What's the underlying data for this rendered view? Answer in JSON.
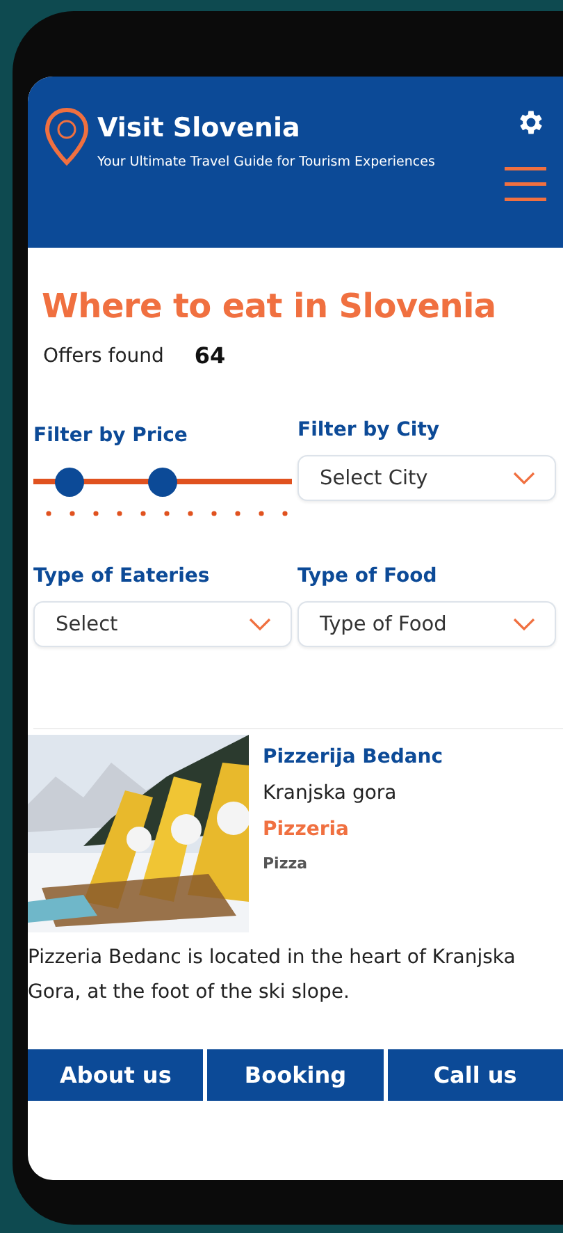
{
  "header": {
    "title": "Visit Slovenia",
    "subtitle": "Your Ultimate Travel Guide for Tourism Experiences"
  },
  "heading": "Where to eat in Slovenia",
  "offers": {
    "label": "Offers found",
    "count": "64"
  },
  "filters": [
    {
      "kind": "slider",
      "label": "Filter by Price",
      "thumbs": [
        {
          "level": 0.14
        },
        {
          "level": 0.5
        }
      ]
    },
    {
      "kind": "select",
      "label": "Filter by City",
      "value": "Select City"
    },
    {
      "kind": "select",
      "label": "Type of Eateries",
      "value": "Select"
    },
    {
      "kind": "select",
      "label": "Type of Food",
      "value": "Type of Food"
    }
  ],
  "listing": {
    "name": "Pizzerija Bedanc",
    "city": "Kranjska gora",
    "category": "Pizzeria",
    "food": "Pizza",
    "description": "Pizzeria Bedanc is located in the heart of Kranjska Gora, at the foot of the ski slope."
  },
  "nav": [
    "About us",
    "Booking",
    "Call us"
  ]
}
